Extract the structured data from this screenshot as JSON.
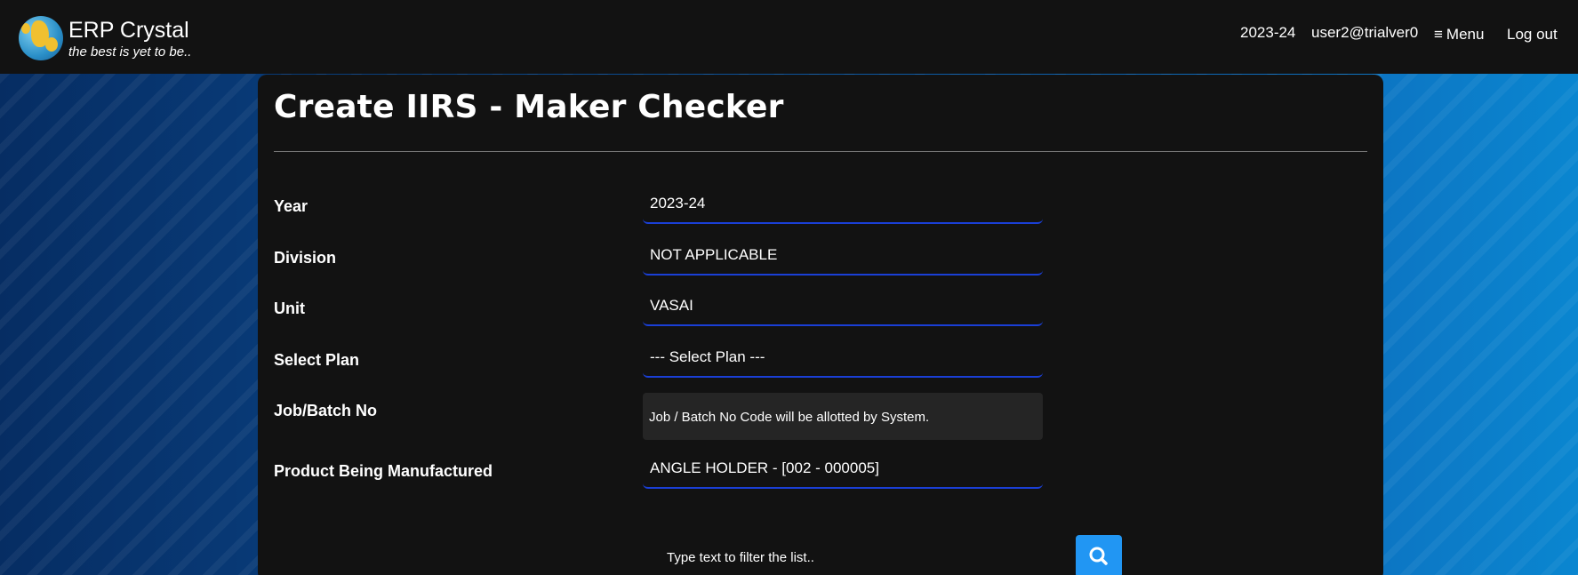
{
  "brand": {
    "title": "ERP Crystal",
    "tagline": "the best is yet to be.."
  },
  "nav": {
    "year": "2023-24",
    "user": "user2@trialver0",
    "menu_label": "Menu",
    "logout_label": "Log out"
  },
  "page": {
    "title": "Create IIRS - Maker Checker"
  },
  "form": {
    "year": {
      "label": "Year",
      "value": "2023-24"
    },
    "division": {
      "label": "Division",
      "value": "NOT APPLICABLE"
    },
    "unit": {
      "label": "Unit",
      "value": "VASAI"
    },
    "plan": {
      "label": "Select Plan",
      "value": "--- Select Plan ---"
    },
    "job_batch": {
      "label": "Job/Batch No",
      "note": "Job / Batch No Code will be allotted by System."
    },
    "product": {
      "label": "Product Being Manufactured",
      "value": "ANGLE HOLDER - [002 - 000005]"
    },
    "filter": {
      "placeholder": "Type text to filter the list.."
    }
  },
  "icons": {
    "logo": "globe-icon",
    "menu": "hamburger-icon",
    "search": "search-icon"
  },
  "colors": {
    "topbar": "#121212",
    "card": "#121212",
    "field_underline": "#1a3fd6",
    "search_button": "#2196f3"
  }
}
